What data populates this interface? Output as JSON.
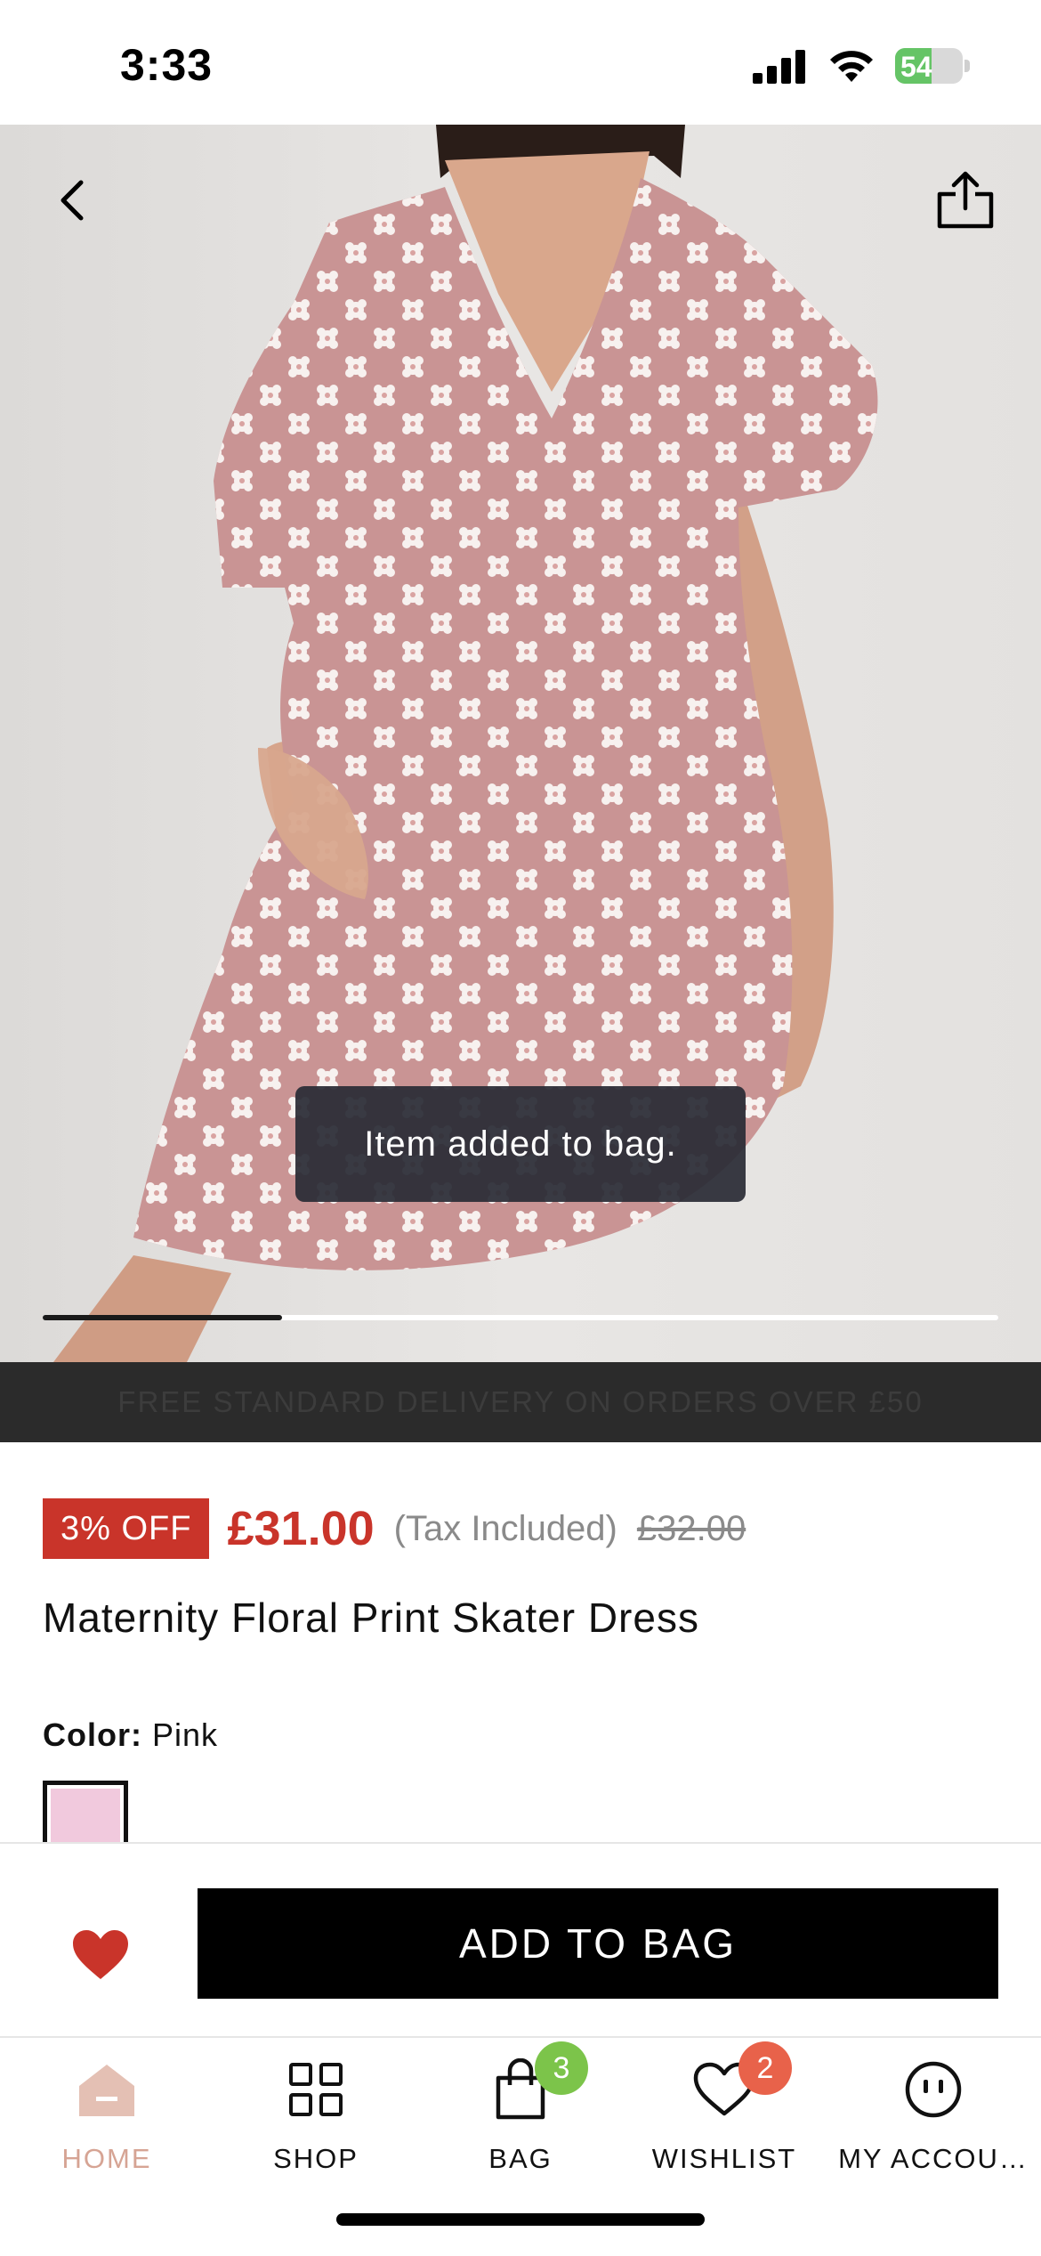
{
  "status_bar": {
    "time": "3:33",
    "battery": "54",
    "battery_level": 0.54
  },
  "image": {
    "carousel_progress": 0.25
  },
  "toast": {
    "message": "Item added to bag."
  },
  "banner": {
    "text": "FREE STANDARD DELIVERY ON ORDERS OVER £50"
  },
  "product": {
    "discount": "3% OFF",
    "price": "£31.00",
    "tax_note": "(Tax Included)",
    "original_price": "£32.00",
    "title": "Maternity Floral Print Skater Dress",
    "color_label": "Color:",
    "color_value": "Pink",
    "swatch_color": "#f1c9dd"
  },
  "actions": {
    "add_to_bag": "ADD TO BAG"
  },
  "tabs": [
    {
      "label": "HOME",
      "icon": "home-icon"
    },
    {
      "label": "SHOP",
      "icon": "grid-icon"
    },
    {
      "label": "BAG",
      "icon": "bag-icon",
      "badge": "3"
    },
    {
      "label": "WISHLIST",
      "icon": "heart-icon",
      "badge": "2"
    },
    {
      "label": "MY ACCOU…",
      "icon": "account-icon"
    }
  ],
  "colors": {
    "accent_red": "#c9342a",
    "home_active": "#d6a494",
    "badge_green": "#7cc44a",
    "badge_orange": "#e8624a"
  }
}
